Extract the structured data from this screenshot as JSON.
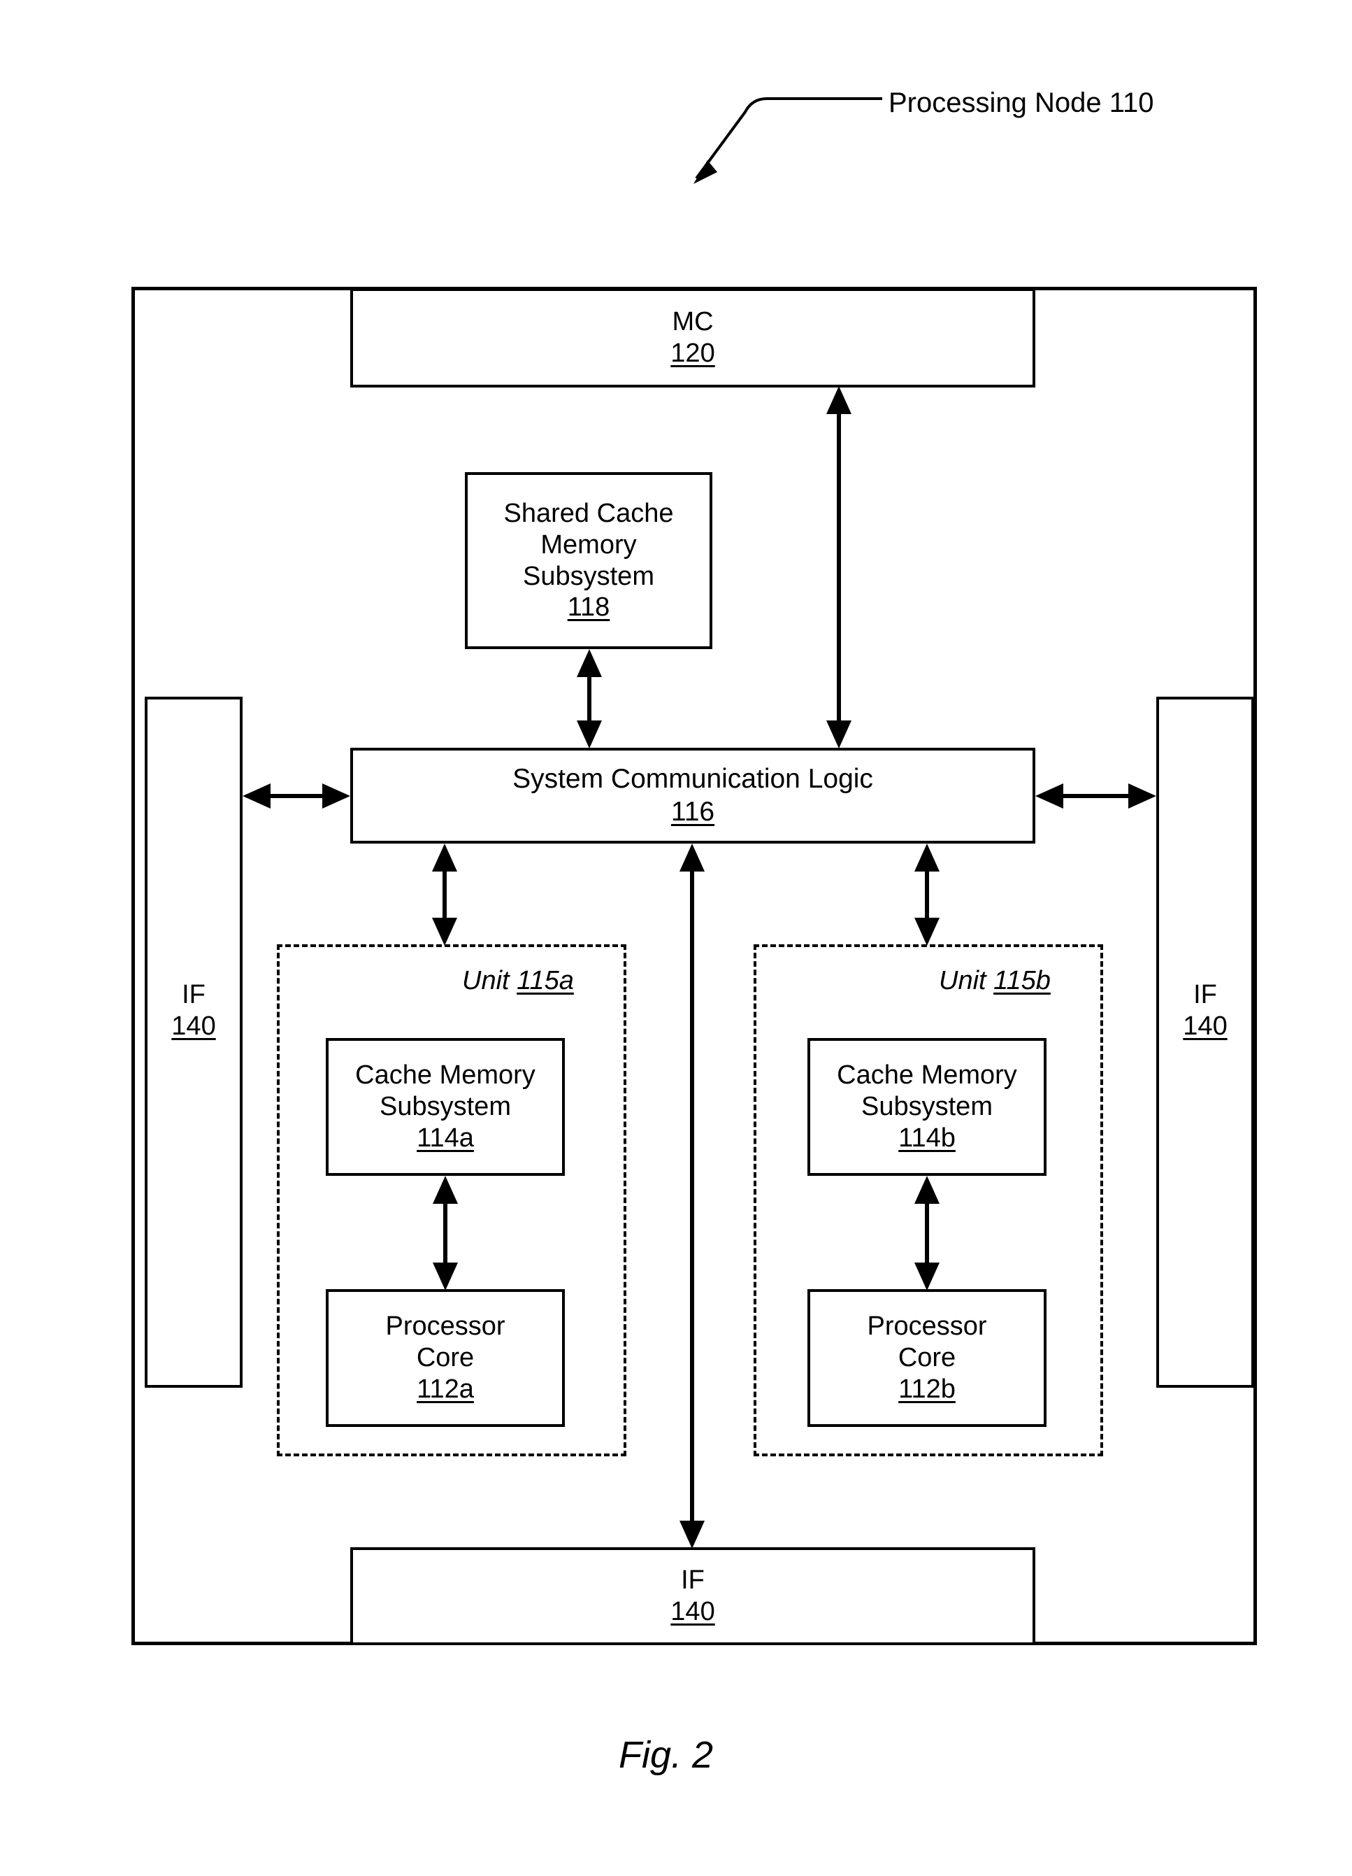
{
  "figure": {
    "caption": "Fig. 2",
    "callout_label": "Processing Node 110"
  },
  "blocks": {
    "mc": {
      "title": "MC",
      "ref": "120"
    },
    "shared_cache": {
      "line1": "Shared Cache",
      "line2": "Memory",
      "line3": "Subsystem",
      "ref": "118"
    },
    "system_comm_logic": {
      "title": "System Communication Logic",
      "ref": "116"
    },
    "if_left": {
      "title": "IF",
      "ref": "140"
    },
    "if_right": {
      "title": "IF",
      "ref": "140"
    },
    "if_bottom": {
      "title": "IF",
      "ref": "140"
    },
    "unit_a": {
      "label_prefix": "Unit ",
      "label_ref": "115a",
      "cache": {
        "line1": "Cache Memory",
        "line2": "Subsystem",
        "ref": "114a"
      },
      "core": {
        "line1": "Processor",
        "line2": "Core",
        "ref": "112a"
      }
    },
    "unit_b": {
      "label_prefix": "Unit ",
      "label_ref": "115b",
      "cache": {
        "line1": "Cache Memory",
        "line2": "Subsystem",
        "ref": "114b"
      },
      "core": {
        "line1": "Processor",
        "line2": "Core",
        "ref": "112b"
      }
    }
  },
  "connectors": [
    {
      "name": "mc-to-system-comm-logic",
      "type": "double-arrow-vertical"
    },
    {
      "name": "shared-cache-to-system-comm-logic",
      "type": "double-arrow-vertical"
    },
    {
      "name": "system-comm-logic-to-if-left",
      "type": "double-arrow-horizontal"
    },
    {
      "name": "system-comm-logic-to-if-right",
      "type": "double-arrow-horizontal"
    },
    {
      "name": "system-comm-logic-to-unit-a",
      "type": "double-arrow-vertical"
    },
    {
      "name": "system-comm-logic-to-unit-b",
      "type": "double-arrow-vertical"
    },
    {
      "name": "system-comm-logic-to-if-bottom",
      "type": "double-arrow-vertical"
    },
    {
      "name": "cache-a-to-core-a",
      "type": "double-arrow-vertical"
    },
    {
      "name": "cache-b-to-core-b",
      "type": "double-arrow-vertical"
    }
  ],
  "style": {
    "line_color": "#000000",
    "background": "#ffffff"
  }
}
